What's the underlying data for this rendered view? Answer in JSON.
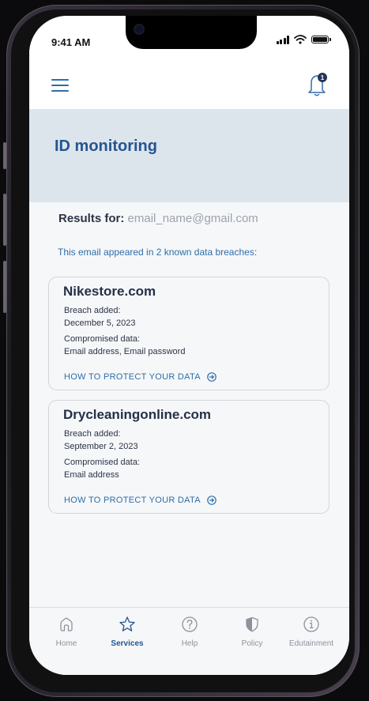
{
  "status_bar": {
    "time": "9:41 AM"
  },
  "header": {
    "notification_count": "1"
  },
  "page": {
    "title": "ID monitoring"
  },
  "results": {
    "label": "Results for:",
    "email": "email_name@gmail.com",
    "summary": "This email appeared in 2 known data breaches:"
  },
  "breaches": [
    {
      "site": "Nikestore.com",
      "breach_added_label": "Breach added:",
      "breach_added_date": "December 5, 2023",
      "compromised_label": "Compromised data:",
      "compromised_value": "Email address, Email password",
      "link": "HOW TO PROTECT YOUR DATA"
    },
    {
      "site": "Drycleaningonline.com",
      "breach_added_label": "Breach added:",
      "breach_added_date": "September 2, 2023",
      "compromised_label": "Compromised data:",
      "compromised_value": "Email address",
      "link": "HOW TO PROTECT YOUR DATA"
    }
  ],
  "tabs": [
    {
      "label": "Home",
      "icon": "home-icon",
      "active": false
    },
    {
      "label": "Services",
      "icon": "star-icon",
      "active": true
    },
    {
      "label": "Help",
      "icon": "question-icon",
      "active": false
    },
    {
      "label": "Policy",
      "icon": "shield-icon",
      "active": false
    },
    {
      "label": "Edutainment",
      "icon": "info-icon",
      "active": false
    }
  ],
  "colors": {
    "primary": "#24558f",
    "link": "#2d6ea8",
    "hero_bg": "#dde5ec",
    "text": "#2b3446",
    "muted": "#9aa3ae"
  }
}
